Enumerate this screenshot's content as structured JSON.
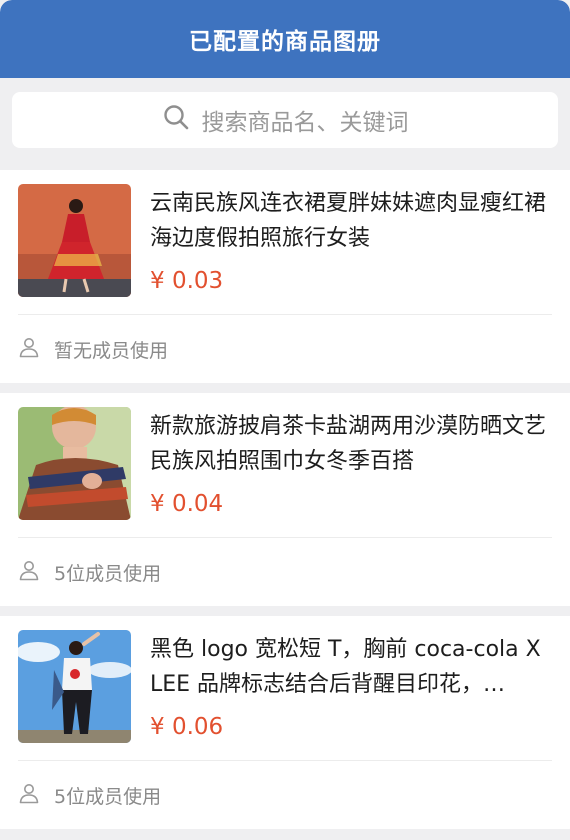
{
  "header": {
    "title": "已配置的商品图册"
  },
  "search": {
    "placeholder": "搜索商品名、关键词",
    "icon": "search-icon"
  },
  "products": [
    {
      "name": "云南民族风连衣裙夏胖妹妹遮肉显瘦红裙海边度假拍照旅行女装",
      "price": "¥ 0.03",
      "members": "暂无成员使用"
    },
    {
      "name": "新款旅游披肩茶卡盐湖两用沙漠防晒文艺民族风拍照围巾女冬季百搭",
      "price": "¥ 0.04",
      "members": "5位成员使用"
    },
    {
      "name": "黑色 logo 宽松短 T，胸前 coca-cola X LEE 品牌标志结合后背醒目印花，…",
      "price": "¥ 0.06",
      "members": "5位成员使用"
    }
  ],
  "colors": {
    "header_bg": "#3e73bf",
    "price": "#e2502f",
    "page_bg": "#efeff1"
  }
}
